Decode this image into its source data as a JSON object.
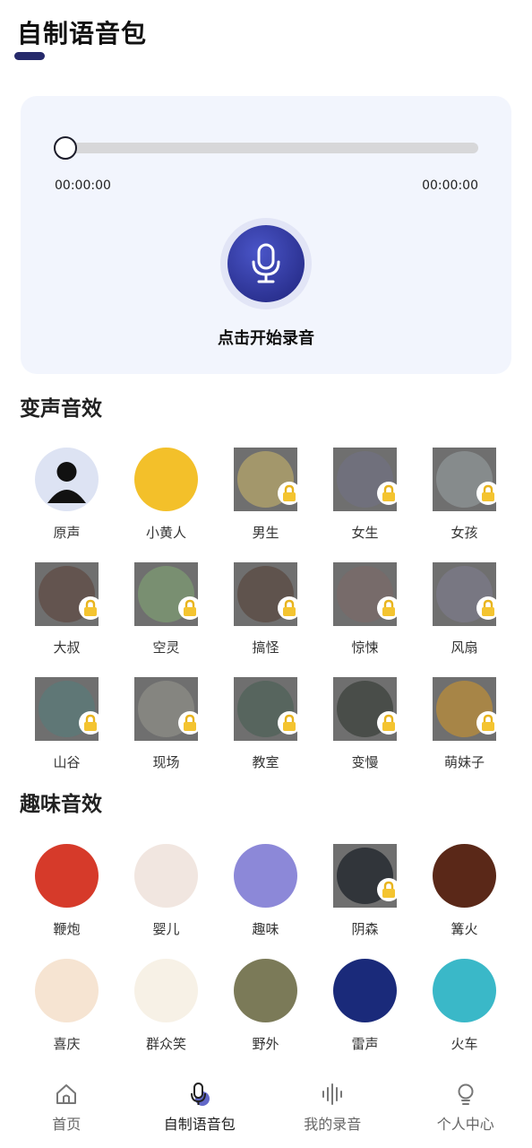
{
  "header": {
    "title": "自制语音包"
  },
  "recorder": {
    "time_start": "00:00:00",
    "time_end": "00:00:00",
    "progress": 0,
    "action_label": "点击开始录音"
  },
  "voice_effects": {
    "title": "变声音效",
    "items": [
      {
        "label": "原声",
        "locked": false,
        "color": "#dde3f3",
        "icon": "person-icon"
      },
      {
        "label": "小黄人",
        "locked": false,
        "color": "#f3c02a",
        "icon": "minion-icon"
      },
      {
        "label": "男生",
        "locked": true,
        "color": "#b4a46a",
        "icon": "boy-icon"
      },
      {
        "label": "女生",
        "locked": true,
        "color": "#707080",
        "icon": "girl-icon"
      },
      {
        "label": "女孩",
        "locked": true,
        "color": "#8e9496",
        "icon": "little-girl-icon"
      },
      {
        "label": "大叔",
        "locked": true,
        "color": "#5f4b44",
        "icon": "uncle-icon"
      },
      {
        "label": "空灵",
        "locked": true,
        "color": "#7c9a72",
        "icon": "landscape-icon"
      },
      {
        "label": "搞怪",
        "locked": true,
        "color": "#5a4a42",
        "icon": "monster-icon"
      },
      {
        "label": "惊悚",
        "locked": true,
        "color": "#7a6a68",
        "icon": "scary-face-icon"
      },
      {
        "label": "风扇",
        "locked": true,
        "color": "#7b7a88",
        "icon": "fan-icon"
      },
      {
        "label": "山谷",
        "locked": true,
        "color": "#5a7a78",
        "icon": "valley-icon"
      },
      {
        "label": "现场",
        "locked": true,
        "color": "#8c8c86",
        "icon": "crowd-icon"
      },
      {
        "label": "教室",
        "locked": true,
        "color": "#4f6258",
        "icon": "classroom-icon"
      },
      {
        "label": "变慢",
        "locked": true,
        "color": "#3c423c",
        "icon": "slow-icon"
      },
      {
        "label": "萌妹子",
        "locked": true,
        "color": "#b98c3a",
        "icon": "cute-girl-icon"
      }
    ]
  },
  "fun_effects": {
    "title": "趣味音效",
    "items": [
      {
        "label": "鞭炮",
        "locked": false,
        "color": "#d63a2a",
        "icon": "firecracker-icon"
      },
      {
        "label": "婴儿",
        "locked": false,
        "color": "#f1e6e0",
        "icon": "baby-icon"
      },
      {
        "label": "趣味",
        "locked": false,
        "color": "#8c88d8",
        "icon": "fun-box-icon"
      },
      {
        "label": "阴森",
        "locked": true,
        "color": "#1c2228",
        "icon": "gloomy-icon"
      },
      {
        "label": "篝火",
        "locked": false,
        "color": "#5a2818",
        "icon": "bonfire-icon"
      },
      {
        "label": "喜庆",
        "locked": false,
        "color": "#f6e4d2",
        "icon": "lantern-icon"
      },
      {
        "label": "群众笑",
        "locked": false,
        "color": "#f7f1e6",
        "icon": "laughing-emoji-icon"
      },
      {
        "label": "野外",
        "locked": false,
        "color": "#7b7a58",
        "icon": "outdoor-icon"
      },
      {
        "label": "雷声",
        "locked": false,
        "color": "#1a2a7a",
        "icon": "thunder-icon"
      },
      {
        "label": "火车",
        "locked": false,
        "color": "#3ab8c8",
        "icon": "train-icon"
      }
    ]
  },
  "tabs": [
    {
      "label": "首页",
      "icon": "home-icon",
      "active": false
    },
    {
      "label": "自制语音包",
      "icon": "microphone-icon",
      "active": true
    },
    {
      "label": "我的录音",
      "icon": "waveform-icon",
      "active": false
    },
    {
      "label": "个人中心",
      "icon": "lightbulb-icon",
      "active": false
    }
  ],
  "colors": {
    "accent": "#2f3596",
    "card_bg": "#f2f5fd",
    "title_underline": "#262a6b"
  }
}
